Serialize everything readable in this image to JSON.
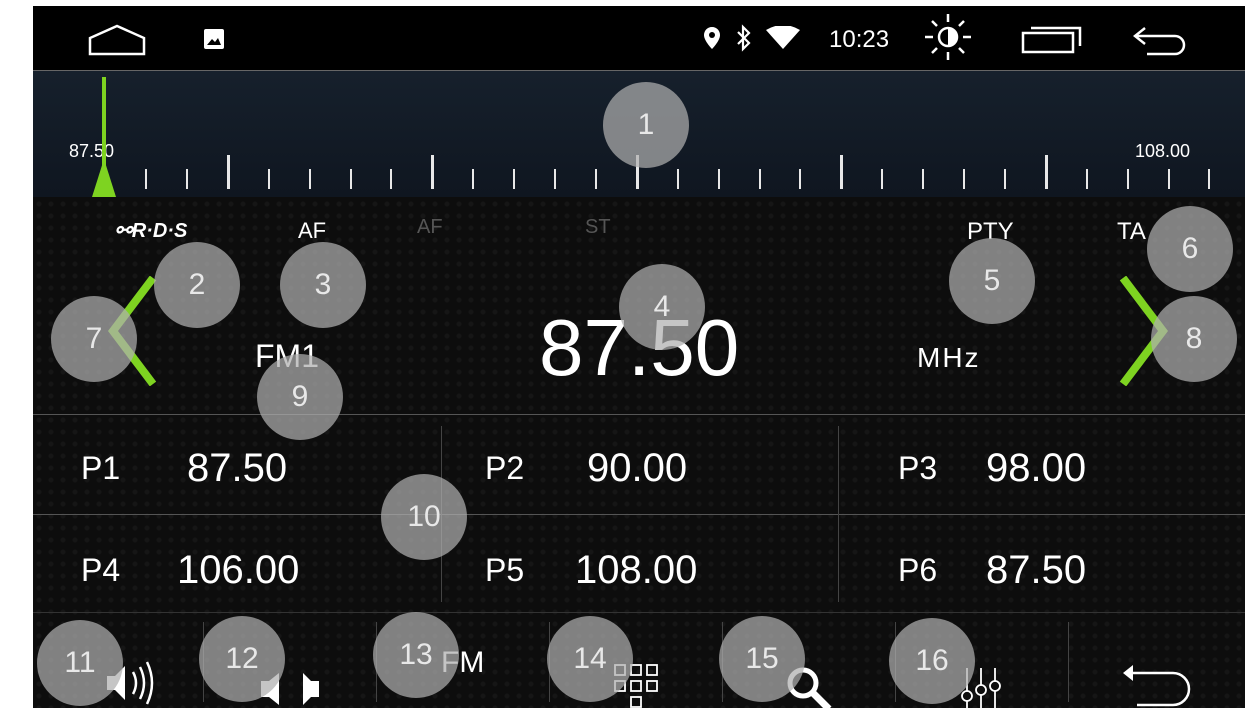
{
  "status_bar": {
    "time": "10:23"
  },
  "tuner": {
    "min_label": "87.50",
    "max_label": "108.00"
  },
  "indicators": {
    "rds": "R·D·S",
    "af_active": "AF",
    "af_inactive": "AF",
    "st": "ST",
    "pty": "PTY",
    "ta": "TA"
  },
  "main": {
    "band": "FM1",
    "frequency": "87.50",
    "unit": "MHz"
  },
  "presets": [
    {
      "label": "P1",
      "freq": "87.50"
    },
    {
      "label": "P2",
      "freq": "90.00"
    },
    {
      "label": "P3",
      "freq": "98.00"
    },
    {
      "label": "P4",
      "freq": "106.00"
    },
    {
      "label": "P5",
      "freq": "108.00"
    },
    {
      "label": "P6",
      "freq": "87.50"
    }
  ],
  "bottom_bar": {
    "band_button": "FM"
  },
  "callouts": [
    "1",
    "2",
    "3",
    "4",
    "5",
    "6",
    "7",
    "8",
    "9",
    "10",
    "11",
    "12",
    "13",
    "14",
    "15",
    "16"
  ],
  "colors": {
    "accent_green": "#7ed321",
    "background": "#0d0d0d"
  }
}
